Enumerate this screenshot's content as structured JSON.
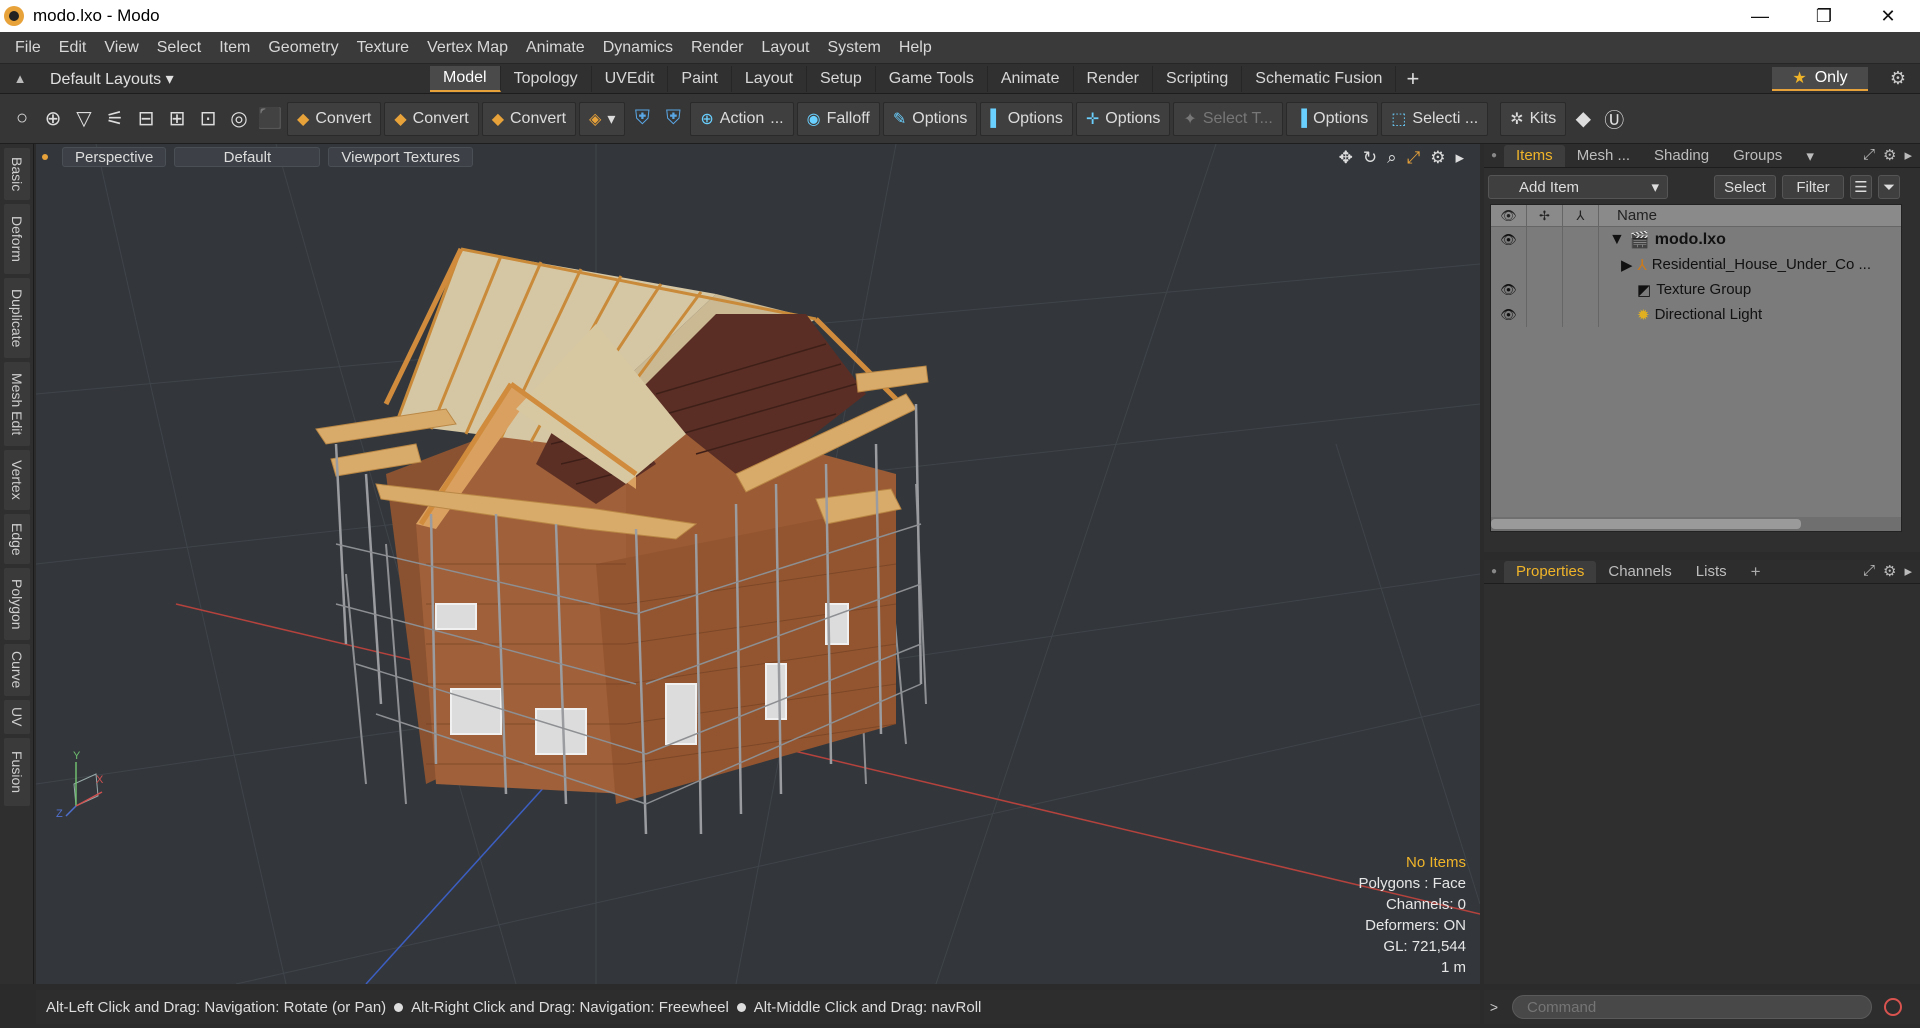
{
  "window": {
    "title": "modo.lxo - Modo",
    "controls": {
      "minimize": "—",
      "restore": "❐",
      "close": "✕"
    }
  },
  "menu": [
    "File",
    "Edit",
    "View",
    "Select",
    "Item",
    "Geometry",
    "Texture",
    "Vertex Map",
    "Animate",
    "Dynamics",
    "Render",
    "Layout",
    "System",
    "Help"
  ],
  "layout_bar": {
    "layouts_label": "Default Layouts ▾",
    "tabs": [
      "Model",
      "Topology",
      "UVEdit",
      "Paint",
      "Layout",
      "Setup",
      "Game Tools",
      "Animate",
      "Render",
      "Scripting",
      "Schematic Fusion"
    ],
    "active_tab": "Model",
    "add": "+",
    "only": "Only",
    "star": "★"
  },
  "toolbar": {
    "convert1": "Convert",
    "convert2": "Convert",
    "convert3": "Convert",
    "action": "Action",
    "action_more": "...",
    "falloff": "Falloff",
    "options1": "Options",
    "options2": "Options",
    "options3": "Options",
    "select_t": "Select T...",
    "options4": "Options",
    "selecti": "Selecti ...",
    "kits": "Kits"
  },
  "left_tabs": [
    "Basic",
    "Deform",
    "Duplicate",
    "Mesh Edit",
    "Vertex",
    "Edge",
    "Polygon",
    "Curve",
    "UV",
    "Fusion"
  ],
  "viewport": {
    "perspective": "Perspective",
    "shading": "Default",
    "textures": "Viewport Textures",
    "info": {
      "selection": "No Items",
      "polygons": "Polygons : Face",
      "channels": "Channels: 0",
      "deformers": "Deformers: ON",
      "gl": "GL: 721,544",
      "scale": "1 m"
    },
    "axis": {
      "y": "Y",
      "x": "X",
      "z": "Z"
    }
  },
  "status": {
    "hint1": "Alt-Left Click and Drag: Navigation: Rotate (or Pan)",
    "hint2": "Alt-Right Click and Drag: Navigation: Freewheel",
    "hint3": "Alt-Middle Click and Drag: navRoll"
  },
  "items_panel": {
    "tabs": [
      "Items",
      "Mesh ...",
      "Shading",
      "Groups"
    ],
    "active_tab": "Items",
    "add_item": "Add Item",
    "select": "Select",
    "filter": "Filter",
    "name_header": "Name",
    "rows": [
      {
        "label": "modo.lxo",
        "icon": "scene-icon",
        "indent": 0,
        "expand": "▼",
        "visible": true
      },
      {
        "label": "Residential_House_Under_Co ...",
        "icon": "mesh-icon",
        "indent": 1,
        "expand": "▶",
        "visible": false
      },
      {
        "label": "Texture Group",
        "icon": "texture-group-icon",
        "indent": 1,
        "expand": "",
        "visible": true
      },
      {
        "label": "Directional Light",
        "icon": "light-icon",
        "indent": 1,
        "expand": "",
        "visible": true
      }
    ]
  },
  "properties_panel": {
    "tabs": [
      "Properties",
      "Channels",
      "Lists"
    ],
    "active_tab": "Properties",
    "add": "+"
  },
  "command": {
    "prompt": ">",
    "placeholder": "Command"
  },
  "colors": {
    "accent": "#e8a23a",
    "highlight_text": "#f0b429"
  }
}
